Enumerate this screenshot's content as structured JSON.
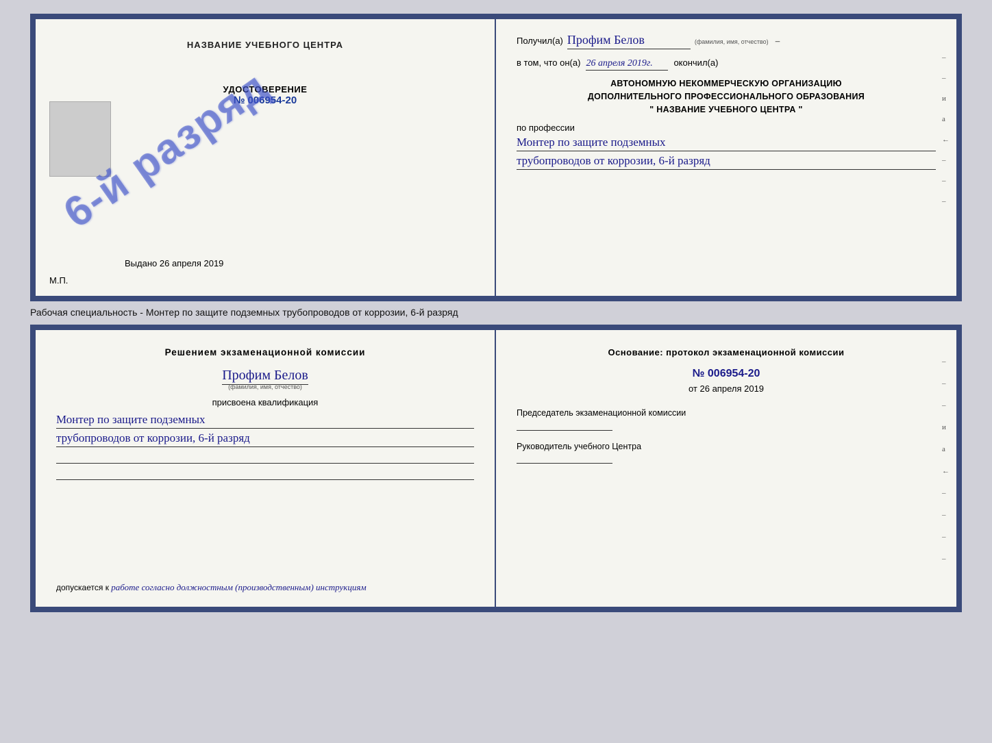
{
  "page": {
    "background_color": "#d0d0d8"
  },
  "top_cert": {
    "left": {
      "title": "НАЗВАНИЕ УЧЕБНОГО ЦЕНТРА",
      "stamp_text": "6-й разряд",
      "udostoverenie_label": "УДОСТОВЕРЕНИЕ",
      "number_prefix": "№",
      "number": "006954-20",
      "vydano_label": "Выдано",
      "vydano_date": "26 апреля 2019",
      "mp": "М.П."
    },
    "right": {
      "poluchil_label": "Получил(а)",
      "name": "Профим Белов",
      "name_sublabel": "(фамилия, имя, отчество)",
      "dash1": "–",
      "vtom_label": "в том, что он(а)",
      "date_filled": "26 апреля 2019г.",
      "okonchil_label": "окончил(а)",
      "org_line1": "АВТОНОМНУЮ НЕКОММЕРЧЕСКУЮ ОРГАНИЗАЦИЮ",
      "org_line2": "ДОПОЛНИТЕЛЬНОГО ПРОФЕССИОНАЛЬНОГО ОБРАЗОВАНИЯ",
      "org_name": "\" НАЗВАНИЕ УЧЕБНОГО ЦЕНТРА \"",
      "po_professii": "по профессии",
      "profession_line1": "Монтер по защите подземных",
      "profession_line2": "трубопроводов от коррозии, 6-й разряд",
      "side_chars": [
        "–",
        "–",
        "и",
        "а",
        "←",
        "–",
        "–",
        "–"
      ]
    }
  },
  "caption": "Рабочая специальность - Монтер по защите подземных трубопроводов от коррозии, 6-й разряд",
  "bottom_cert": {
    "left": {
      "resheniem_label": "Решением экзаменационной комиссии",
      "name": "Профим Белов",
      "name_sublabel": "(фамилия, имя, отчество)",
      "prisvoena_label": "присвоена квалификация",
      "profession_line1": "Монтер по защите подземных",
      "profession_line2": "трубопроводов от коррозии, 6-й разряд",
      "dopuskaetsya_label": "допускается к",
      "dopuskaetsya_text": "работе согласно должностным (производственным) инструкциям"
    },
    "right": {
      "osnovanie_label": "Основание: протокол экзаменационной комиссии",
      "number_prefix": "№",
      "number": "006954-20",
      "ot_prefix": "от",
      "ot_date": "26 апреля 2019",
      "predsedatel_label": "Председатель экзаменационной комиссии",
      "rukovoditel_label": "Руководитель учебного Центра",
      "side_chars": [
        "–",
        "–",
        "–",
        "и",
        "а",
        "←",
        "–",
        "–",
        "–",
        "–"
      ]
    }
  }
}
